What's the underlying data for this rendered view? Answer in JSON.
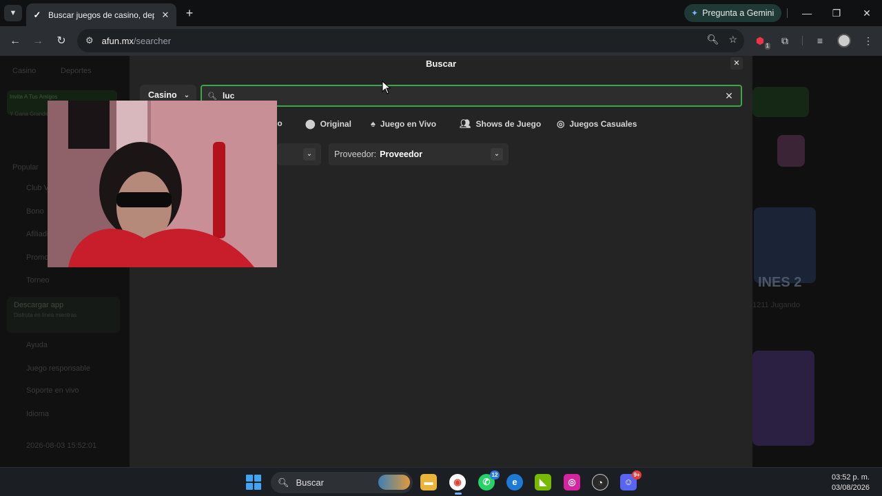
{
  "browser": {
    "tab_title": "Buscar juegos de casino, depor",
    "url_host": "afun.mx",
    "url_path": "/searcher",
    "gemini_label": "Pregunta a Gemini",
    "extension_badge": "1"
  },
  "background": {
    "sidebar_items": [
      "Casino",
      "Deportes",
      "Invita A Tus Amigos",
      "Y Gana Grandes Recompensas",
      "Popular",
      "Club VIP",
      "Bono",
      "Afiliado",
      "Promociones",
      "Torneo",
      "Descargar app",
      "Disfruta en línea mientras",
      "Ayuda",
      "Juego responsable",
      "Soporte en vivo",
      "Idioma",
      "2026-08-03 15:52:01"
    ],
    "banner_text": "INES 2",
    "banner_sub": "1211 Jugando"
  },
  "modal": {
    "title": "Buscar",
    "category": "Casino",
    "search_value": "luc",
    "filters": [
      "no",
      "Original",
      "Juego en Vivo",
      "Shows de Juego",
      "Juegos Casuales"
    ],
    "provider_label": "Proveedor:",
    "provider_value": "Proveedor"
  },
  "taskbar": {
    "search_label": "Buscar",
    "whatsapp_badge": "12",
    "discord_badge": "9+",
    "time": "03:52 p. m.",
    "date": "03/08/2026"
  },
  "colors": {
    "accent_green": "#3aa74a",
    "modal_bg": "#242424"
  }
}
